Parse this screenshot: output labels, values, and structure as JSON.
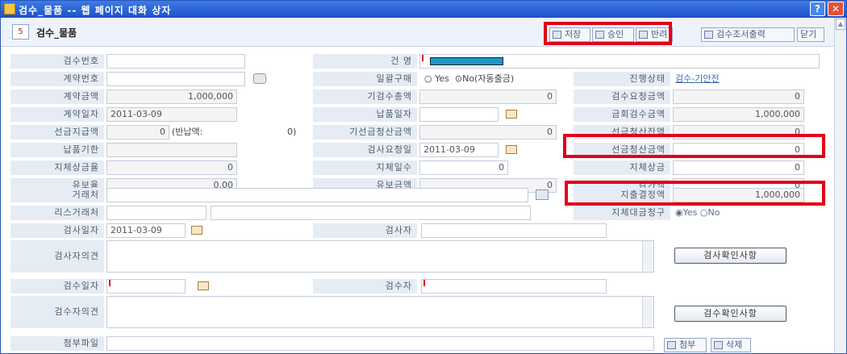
{
  "window": {
    "title": "검수_물품 -- 웹 페이지 대화 상자",
    "help_label": "?",
    "close_label": "✕"
  },
  "header": {
    "icon_label": "5",
    "title": "검수_물품",
    "buttons": {
      "save": "저장",
      "approve": "승인",
      "return": "반려",
      "print": "검수조서출력",
      "close": "닫기"
    }
  },
  "form": {
    "inspection_no": {
      "label": "검수번호",
      "value": ""
    },
    "subject": {
      "label": "건 명",
      "value": ""
    },
    "contract_no": {
      "label": "계약번호",
      "value": ""
    },
    "bulk_purchase": {
      "label": "일괄구매",
      "yes": "Yes",
      "no": "No(자동출금)"
    },
    "progress": {
      "label": "진행상태",
      "value": "검수-기안전"
    },
    "contract_amount": {
      "label": "계약금액",
      "value": "1,000,000"
    },
    "prev_inspection_total": {
      "label": "기검수총액",
      "value": "0"
    },
    "inspection_request_amount": {
      "label": "검수요청금액",
      "value": "0"
    },
    "contract_date": {
      "label": "계약일자",
      "value": "2011-03-09"
    },
    "delivery_date": {
      "label": "납품일자",
      "value": ""
    },
    "this_inspection_amount": {
      "label": "금회검수금액",
      "value": "1,000,000"
    },
    "advance_payment": {
      "label": "선금지급액",
      "value": "0",
      "note": "(반납액:",
      "note_value": "0)"
    },
    "prev_advance_settlement": {
      "label": "기선금청산금액",
      "value": "0"
    },
    "advance_remaining": {
      "label": "선금청산잔액",
      "value": "0"
    },
    "delivery_deadline": {
      "label": "납품기한",
      "value": ""
    },
    "inspection_request_date": {
      "label": "검사요청일",
      "value": "2011-03-09"
    },
    "advance_settlement": {
      "label": "선금청산금액",
      "value": "0"
    },
    "late_penalty_rate": {
      "label": "지체상금율",
      "value": "0"
    },
    "late_days": {
      "label": "지체일수",
      "value": "0"
    },
    "late_penalty": {
      "label": "지체상금",
      "value": "0"
    },
    "retention_rate": {
      "label": "유보율",
      "value": "0.00"
    },
    "retention_amount": {
      "label": "유보금액",
      "value": "0"
    },
    "deduction": {
      "label": "감가액",
      "value": "0"
    },
    "vendor": {
      "label": "거래처",
      "value": ""
    },
    "expense_amount": {
      "label": "지출결정액",
      "value": "1,000,000"
    },
    "lease_vendor": {
      "label": "리스거래처",
      "value": ""
    },
    "late_claim": {
      "label": "지체대금청구",
      "yes": "Yes",
      "no": "No"
    },
    "inspect_date": {
      "label": "검사일자",
      "value": "2011-03-09"
    },
    "inspector": {
      "label": "검사자",
      "value": ""
    },
    "inspector_opinion": {
      "label": "검사자의견",
      "value": "",
      "button": "검사확인사항"
    },
    "receive_date": {
      "label": "검수일자",
      "value": ""
    },
    "receiver": {
      "label": "검수자",
      "value": ""
    },
    "receiver_opinion": {
      "label": "검수자의견",
      "value": "",
      "button": "검수확인사항"
    },
    "attachment": {
      "label": "첨부파일",
      "value": "",
      "attach": "첨부",
      "delete": "삭제"
    }
  },
  "colors": {
    "titlebar": "#1d50c6",
    "highlight": "#e2001a",
    "subject_fill": "#1b97c8",
    "link": "#3e6bb7"
  }
}
